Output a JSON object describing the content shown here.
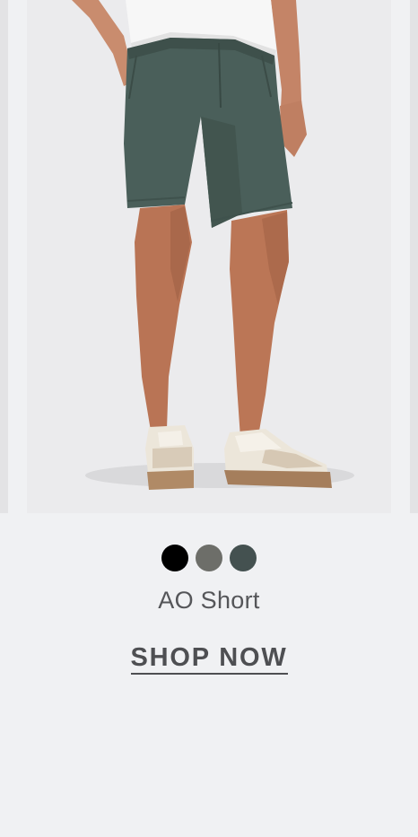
{
  "product": {
    "name": "AO Short",
    "image_alt": "Model wearing green chino shorts with white t-shirt and suede sneakers"
  },
  "swatches": [
    {
      "name": "black",
      "color": "#000000"
    },
    {
      "name": "grey",
      "color": "#6d6e69"
    },
    {
      "name": "green",
      "color": "#445150"
    }
  ],
  "cta": {
    "label": "SHOP NOW"
  },
  "colors": {
    "background": "#f0f1f3",
    "text": "#555659"
  }
}
